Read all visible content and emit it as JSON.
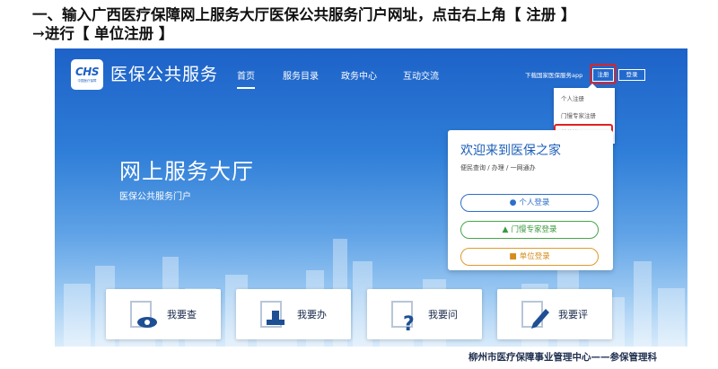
{
  "instruction": {
    "line1": "一、输入广西医疗保障网上服务大厅医保公共服务门户网址，点击右上角【 注册 】",
    "line2": "→进行【 单位注册 】"
  },
  "logo": {
    "text": "CHS",
    "sub": "中国医疗保障"
  },
  "header": {
    "site_name": "医保公共服务",
    "nav": [
      "首页",
      "服务目录",
      "政务中心",
      "互动交流"
    ],
    "app_download": "下载国家医保服务app",
    "register": "注册",
    "login": "登录"
  },
  "register_menu": [
    "个人注册",
    "门慢专家注册",
    "单位注册"
  ],
  "hero": {
    "title": "网上服务大厅",
    "subtitle": "医保公共服务门户"
  },
  "welcome": {
    "title": "欢迎来到医保之家",
    "desc": "便民查询 / 办理 / 一网通办",
    "personal_login": "个人登录",
    "expert_login": "门慢专家登录",
    "unit_login": "单位登录"
  },
  "services": [
    "我要查",
    "我要办",
    "我要问",
    "我要评"
  ],
  "footer_note": "柳州市医疗保障事业管理中心——参保管理科",
  "colors": {
    "highlight": "#e02222",
    "brand_blue": "#1d62c8"
  }
}
